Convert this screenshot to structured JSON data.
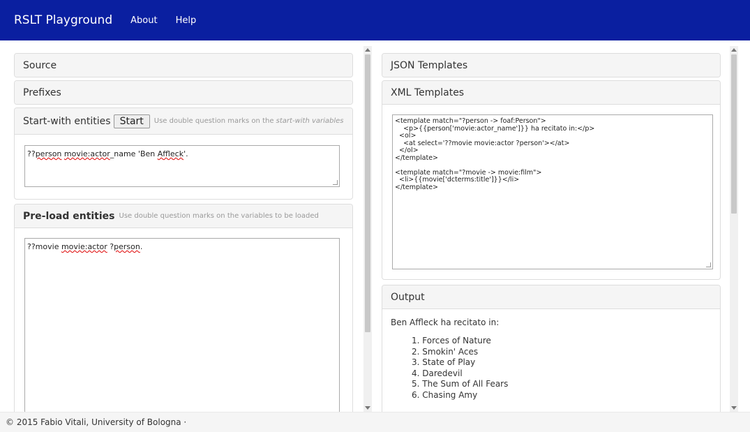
{
  "nav": {
    "brand": "RSLT Playground",
    "links": [
      "About",
      "Help"
    ]
  },
  "left": {
    "source_title": "Source",
    "prefixes_title": "Prefixes",
    "start_with": {
      "title": "Start-with entities",
      "button": "Start",
      "hint_prefix": "Use double question marks on the",
      "hint_italic": "start-with variables",
      "value_parts": [
        "??",
        "person",
        " ",
        "movie:actor",
        "_name 'Ben ",
        "Affleck",
        "'."
      ]
    },
    "preload": {
      "title": "Pre-load entities",
      "hint": "Use double question marks on the variables to be loaded",
      "value_parts": [
        "??movie ",
        "movie:actor",
        " ?",
        "person",
        "."
      ]
    }
  },
  "right": {
    "json_title": "JSON Templates",
    "xml_title": "XML Templates",
    "xml_lines": [
      "<template match=\"?person -> foaf:Person\">",
      "    <p>{{person['movie:actor_name']}} ha recitato in:</p>",
      "  <ol>",
      "    <at select='??movie movie:actor ?person'></at>",
      "  </ol>",
      "</template>",
      "",
      "<template match=\"?movie -> movie:film\">",
      "  <li>{{movie['dcterms:title']}}</li>",
      "</template>"
    ],
    "output_title": "Output",
    "output_heading": "Ben Affleck ha recitato in:",
    "output_items": [
      "1. Forces of Nature",
      "2. Smokin' Aces",
      "3. State of Play",
      "4. Daredevil",
      "5. The Sum of All Fears",
      "6. Chasing Amy"
    ]
  },
  "footer": {
    "text": "© 2015 Fabio Vitali, University of Bologna ·"
  },
  "colors": {
    "navbar": "#0a1fa0",
    "panel_heading": "#f5f5f5",
    "border": "#dddddd"
  }
}
